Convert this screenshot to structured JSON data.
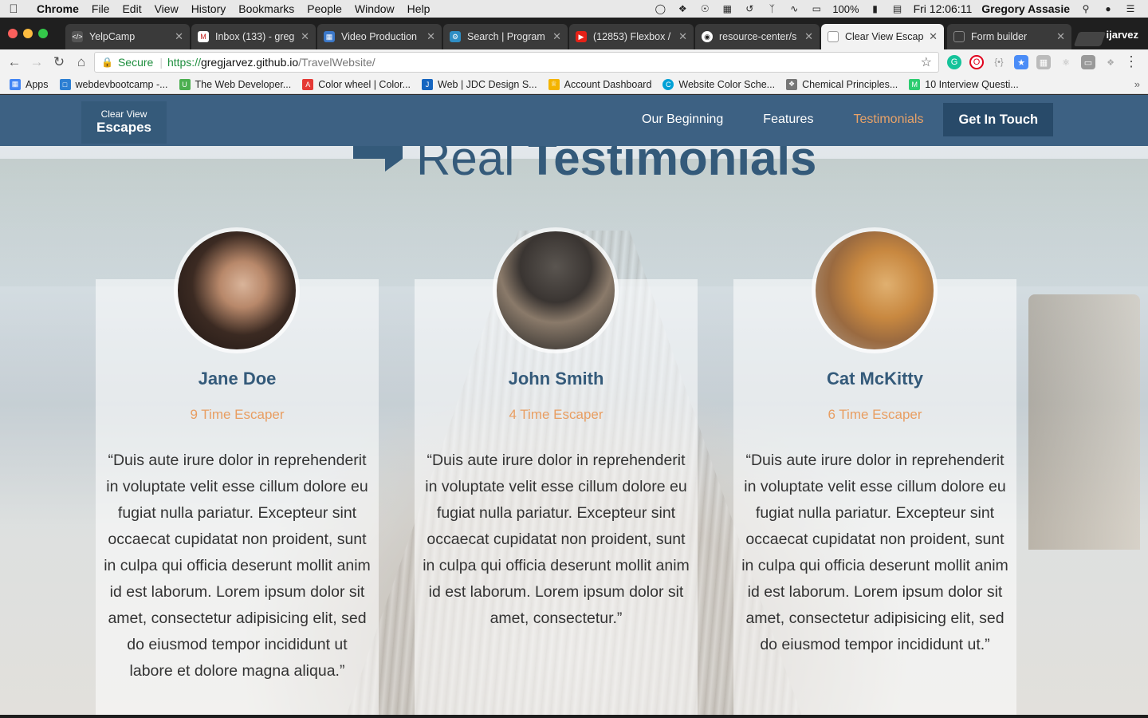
{
  "menubar": {
    "app": "Chrome",
    "items": [
      "File",
      "Edit",
      "View",
      "History",
      "Bookmarks",
      "People",
      "Window",
      "Help"
    ],
    "battery": "100%",
    "clock": "Fri 12:06:11",
    "user": "Gregory Assasie"
  },
  "tabs": [
    {
      "title": "YelpCamp",
      "color": "#555555"
    },
    {
      "title": "Inbox (133) - greg",
      "color": "#c5221f"
    },
    {
      "title": "Video Production",
      "color": "#3b78c9"
    },
    {
      "title": "Search | Program",
      "color": "#2f8ec5"
    },
    {
      "title": "(12853) Flexbox /",
      "color": "#e62117"
    },
    {
      "title": "resource-center/s",
      "color": "#333333"
    },
    {
      "title": "Clear View Escape",
      "color": "#999999"
    },
    {
      "title": "Form builder",
      "color": "#888888"
    }
  ],
  "profile": "ijarvez",
  "address": {
    "secure_label": "Secure",
    "scheme": "https://",
    "host": "gregjarvez.github.io",
    "path": "/TravelWebsite/"
  },
  "bookmarks": [
    {
      "label": "Apps",
      "color": "#4285f4"
    },
    {
      "label": "webdevbootcamp -...",
      "color": "#2d7fd3"
    },
    {
      "label": "The Web Developer...",
      "color": "#4caf50"
    },
    {
      "label": "Color wheel | Color...",
      "color": "#e53935"
    },
    {
      "label": "Web | JDC Design S...",
      "color": "#1565c0"
    },
    {
      "label": "Account Dashboard",
      "color": "#f4b400"
    },
    {
      "label": "Website Color Sche...",
      "color": "#00a1d6"
    },
    {
      "label": "Chemical Principles...",
      "color": "#777777"
    },
    {
      "label": "10 Interview Questi...",
      "color": "#2ecc71"
    }
  ],
  "site": {
    "brand_line1": "Clear View",
    "brand_line2": "Escapes",
    "nav": [
      "Our Beginning",
      "Features",
      "Testimonials"
    ],
    "cta": "Get In Touch",
    "heading_thin": "Real",
    "heading_bold": "Testimonials",
    "colors": {
      "navbar": "#3d6183",
      "accent": "#e89e62",
      "heading": "#345a7a"
    }
  },
  "testimonials": [
    {
      "name": "Jane Doe",
      "rank": "9 Time Escaper",
      "quote": "“Duis aute irure dolor in reprehenderit in voluptate velit esse cillum dolore eu fugiat nulla pariatur. Excepteur sint occaecat cupidatat non proident, sunt in culpa qui officia deserunt mollit anim id est laborum. Lorem ipsum dolor sit amet, consectetur adipisicing elit, sed do eiusmod tempor incididunt ut labore et dolore magna aliqua.”"
    },
    {
      "name": "John Smith",
      "rank": "4 Time Escaper",
      "quote": "“Duis aute irure dolor in reprehenderit in voluptate velit esse cillum dolore eu fugiat nulla pariatur. Excepteur sint occaecat cupidatat non proident, sunt in culpa qui officia deserunt mollit anim id est laborum. Lorem ipsum dolor sit amet, consectetur.”"
    },
    {
      "name": "Cat McKitty",
      "rank": "6 Time Escaper",
      "quote": "“Duis aute irure dolor in reprehenderit in voluptate velit esse cillum dolore eu fugiat nulla pariatur. Excepteur sint occaecat cupidatat non proident, sunt in culpa qui officia deserunt mollit anim id est laborum. Lorem ipsum dolor sit amet, consectetur adipisicing elit, sed do eiusmod tempor incididunt ut.”"
    }
  ]
}
